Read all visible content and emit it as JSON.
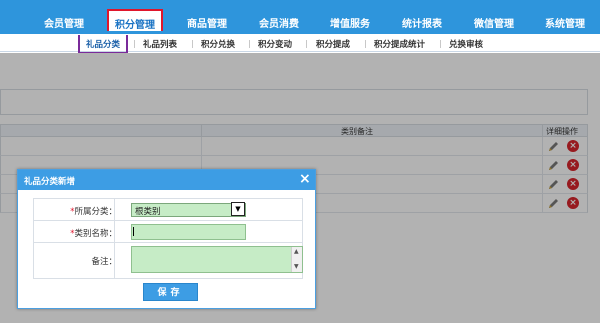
{
  "top_nav": {
    "items": [
      "会员管理",
      "积分管理",
      "商品管理",
      "会员消费",
      "增值服务",
      "统计报表",
      "微信管理",
      "系统管理"
    ],
    "active_index": 1
  },
  "sub_nav": {
    "items": [
      "礼品分类",
      "礼品列表",
      "积分兑换",
      "积分变动",
      "积分提成",
      "积分提成统计",
      "兑换审核"
    ],
    "active_index": 0
  },
  "grid": {
    "headers": {
      "note": "类别备注",
      "ops": "详细操作"
    },
    "row_count": 4
  },
  "dialog": {
    "title": "礼品分类新增",
    "close_icon": "×",
    "fields": {
      "category": {
        "label": "所属分类：",
        "required_mark": "*",
        "value": "根类别"
      },
      "name": {
        "label": "类别名称：",
        "required_mark": "*",
        "value": ""
      },
      "remark": {
        "label": "备注：",
        "value": ""
      }
    },
    "save_label": "保存"
  },
  "colors": {
    "nav_bg": "#2e95dc",
    "dialog_header": "#3d9de4",
    "input_bg": "#c6ecc6",
    "active_nav_border": "#e0162c",
    "active_sub_border": "#7a2a9a"
  }
}
